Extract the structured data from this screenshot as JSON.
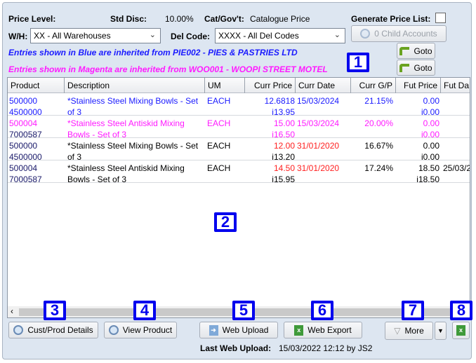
{
  "header": {
    "price_level_label": "Price Level:",
    "std_disc_label": "Std Disc:",
    "std_disc_value": "10.00%",
    "cat_gov_label": "Cat/Gov't:",
    "cat_gov_value": "Catalogue Price",
    "generate_price_list_label": "Generate Price List:",
    "generate_price_list_checked": false,
    "wh_label": "W/H:",
    "wh_value": "XX - All Warehouses",
    "del_code_label": "Del Code:",
    "del_code_value": "XXXX - All Del Codes",
    "child_accounts_label": "0 Child Accounts",
    "info_blue": "Entries shown in Blue are inherited from PIE002 - PIES & PASTRIES LTD",
    "info_magenta": "Entries shown in Magenta are inherited from WOO001 - WOOPI STREET MOTEL",
    "goto_label": "Goto"
  },
  "table": {
    "columns": [
      "Product",
      "Description",
      "UM",
      "Curr Price",
      "Curr Date",
      "Curr G/P",
      "Fut Price",
      "Fut Da"
    ],
    "rows": [
      {
        "product": "500000",
        "code": "4500000",
        "desc1": "*Stainless Steel Mixing Bowls - Set",
        "desc2": "of 3",
        "um": "EACH",
        "curr_price": "12.6818",
        "curr_price_inc": "i13.95",
        "curr_date": "15/03/2024",
        "gp": "21.15%",
        "fut_price": "0.00",
        "fut_price_inc": "i0.00",
        "fut_date": "",
        "style": "blue"
      },
      {
        "product": "500004",
        "code": "7000587",
        "desc1": "*Stainless Steel Antiskid Mixing",
        "desc2": "Bowls - Set of 3",
        "um": "EACH",
        "curr_price": "15.00",
        "curr_price_inc": "i16.50",
        "curr_date": "15/03/2024",
        "gp": "20.00%",
        "fut_price": "0.00",
        "fut_price_inc": "i0.00",
        "fut_date": "",
        "style": "mag"
      },
      {
        "product": "500000",
        "code": "4500000",
        "desc1": "*Stainless Steel Mixing Bowls - Set",
        "desc2": "of 3",
        "um": "EACH",
        "curr_price": "12.00",
        "curr_price_inc": "i13.20",
        "curr_date": "31/01/2020",
        "gp": "16.67%",
        "fut_price": "0.00",
        "fut_price_inc": "i0.00",
        "fut_date": "",
        "style": "own"
      },
      {
        "product": "500004",
        "code": "7000587",
        "desc1": "*Stainless Steel Antiskid Mixing",
        "desc2": "Bowls - Set of 3",
        "um": "EACH",
        "curr_price": "14.50",
        "curr_price_inc": "i15.95",
        "curr_date": "31/01/2020",
        "gp": "17.24%",
        "fut_price": "18.50",
        "fut_price_inc": "i18.50",
        "fut_date": "25/03/2",
        "style": "own"
      }
    ]
  },
  "buttons": {
    "cust_prod": "Cust/Prod Details",
    "view_product": "View Product",
    "web_upload": "Web Upload",
    "web_export": "Web Export",
    "more": "More"
  },
  "footer": {
    "last_upload_label": "Last Web Upload:",
    "last_upload_value": "15/03/2022 12:12 by JS2"
  },
  "badges": [
    "1",
    "2",
    "3",
    "4",
    "5",
    "6",
    "7",
    "8"
  ],
  "colors": {
    "inherited_blue": "#1a1aff",
    "inherited_magenta": "#ff1aff",
    "old_price_red": "#ff2020",
    "badge": "#0000ee"
  }
}
